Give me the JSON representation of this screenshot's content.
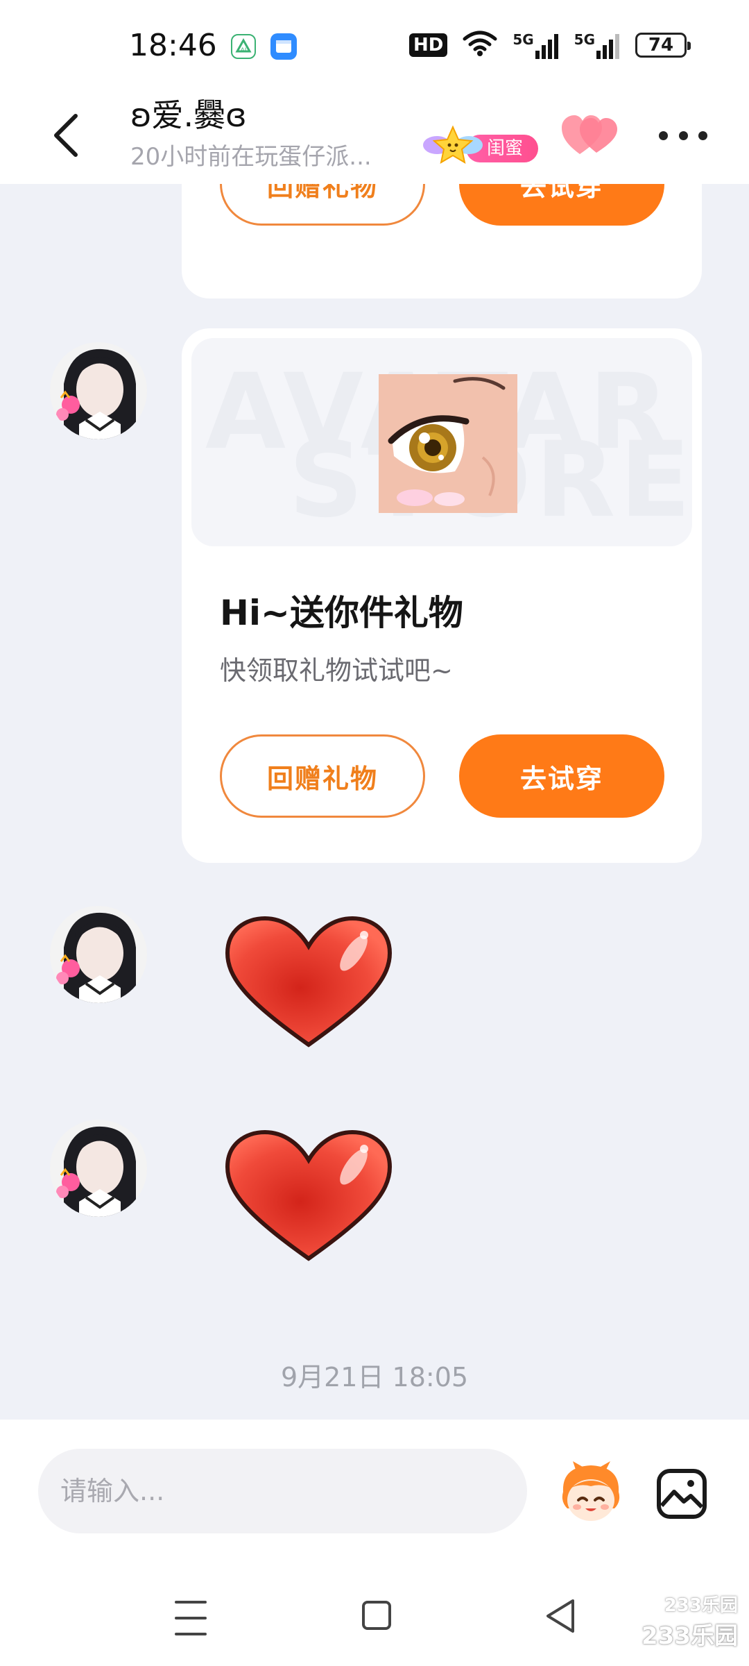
{
  "status_bar": {
    "time": "18:46",
    "battery": "74",
    "hd": "HD",
    "signal_1": "5G",
    "signal_2": "5G",
    "icons": [
      "app-store-icon",
      "files-icon",
      "hd-voice-icon",
      "wifi-icon",
      "signal-5g-icon",
      "signal-5g-icon",
      "battery-icon"
    ]
  },
  "header": {
    "contact_name": "ʚ爱.爨ɞ",
    "contact_status": "20小时前在玩蛋仔派...",
    "relation_tag": "闺蜜",
    "icons": [
      "back-arrow-icon",
      "star-badge-icon",
      "hearts-icon",
      "more-icon"
    ]
  },
  "messages": {
    "card_1": {
      "return_gift": "回赠礼物",
      "try_on": "去试穿"
    },
    "card_2": {
      "banner_watermark_1": "AVATAR",
      "banner_watermark_2": "STORE",
      "title": "Hi~送你件礼物",
      "description": "快领取礼物试试吧~",
      "return_gift": "回赠礼物",
      "try_on": "去试穿"
    },
    "stickers": [
      "heart-sticker",
      "heart-sticker"
    ],
    "timestamp": "9月21日 18:05"
  },
  "input_bar": {
    "placeholder": "请输入...",
    "icons": [
      "emoji-mascot-icon",
      "image-icon"
    ]
  },
  "nav_bar": {
    "icons": [
      "menu-icon",
      "home-icon",
      "back-icon"
    ]
  },
  "watermark": {
    "top": "233乐园",
    "bottom": "233乐园"
  },
  "colors": {
    "accent_orange": "#ff7a17",
    "outline_orange": "#f0883d",
    "relation_pink": "#ff4f8f",
    "heart_red": "#e8352a",
    "chat_background": "#eff1f7"
  }
}
